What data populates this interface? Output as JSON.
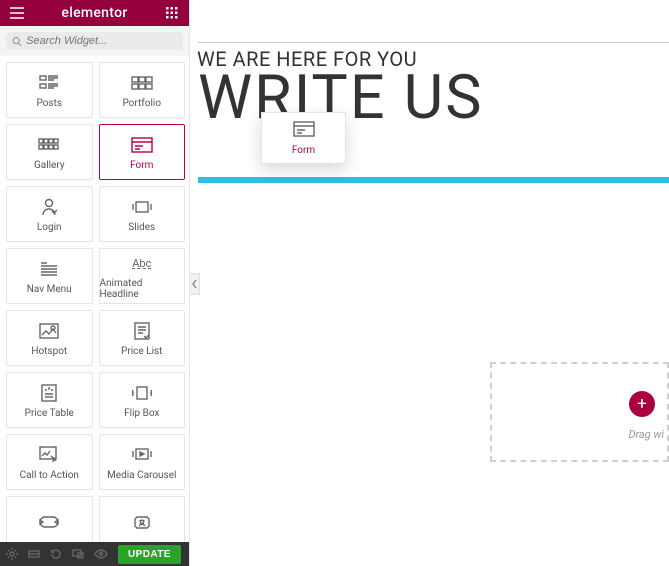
{
  "header": {
    "brand": "elementor"
  },
  "search": {
    "placeholder": "Search Widget..."
  },
  "widgets": [
    {
      "id": "posts",
      "label": "Posts"
    },
    {
      "id": "portfolio",
      "label": "Portfolio"
    },
    {
      "id": "gallery",
      "label": "Gallery"
    },
    {
      "id": "form",
      "label": "Form",
      "active": true
    },
    {
      "id": "login",
      "label": "Login"
    },
    {
      "id": "slides",
      "label": "Slides"
    },
    {
      "id": "nav-menu",
      "label": "Nav Menu"
    },
    {
      "id": "animated-headline",
      "label": "Animated Headline",
      "icon_text": "Abc"
    },
    {
      "id": "hotspot",
      "label": "Hotspot"
    },
    {
      "id": "price-list",
      "label": "Price List"
    },
    {
      "id": "price-table",
      "label": "Price Table"
    },
    {
      "id": "flip-box",
      "label": "Flip Box"
    },
    {
      "id": "call-to-action",
      "label": "Call to Action"
    },
    {
      "id": "media-carousel",
      "label": "Media Carousel"
    },
    {
      "id": "extra-1",
      "label": ""
    },
    {
      "id": "extra-2",
      "label": ""
    }
  ],
  "bottombar": {
    "update_label": "UPDATE"
  },
  "canvas": {
    "subheading": "WE ARE HERE FOR YOU",
    "heading": "WRITE US",
    "dragged_label": "Form",
    "dropzone_text": "Drag wi",
    "accent_cyan": "#2ebfe9"
  },
  "colors": {
    "brand": "#93003c",
    "active": "#b8004a",
    "update": "#29a329"
  }
}
